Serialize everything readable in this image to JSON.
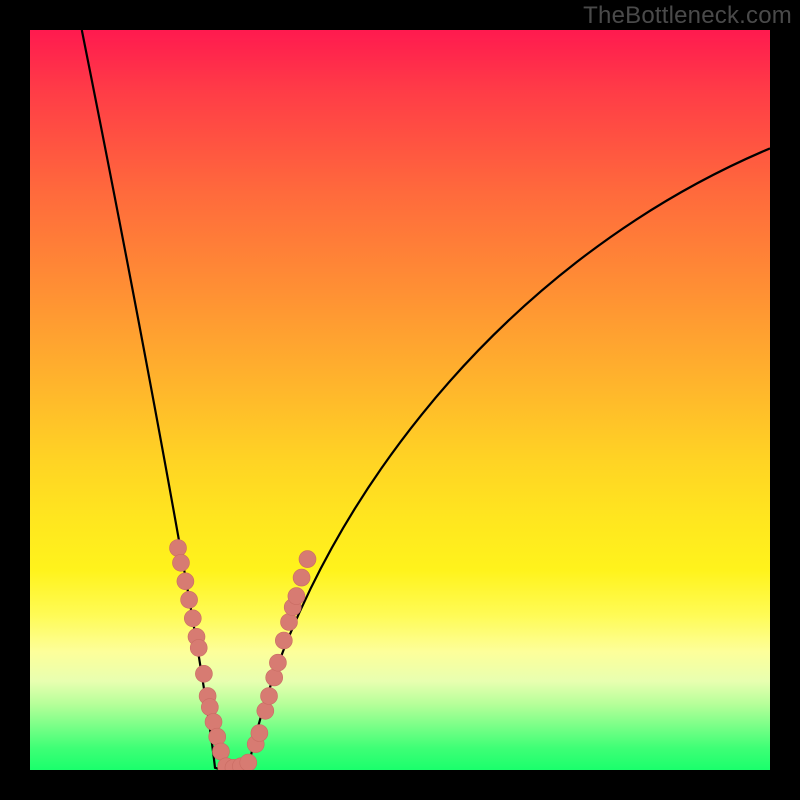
{
  "watermark": "TheBottleneck.com",
  "colors": {
    "curve_stroke": "#000000",
    "marker_fill": "#d77b72",
    "marker_stroke": "#c96c63",
    "frame": "#000000"
  },
  "chart_data": {
    "type": "line",
    "title": "",
    "xlabel": "",
    "ylabel": "",
    "xlim": [
      0,
      100
    ],
    "ylim": [
      0,
      100
    ],
    "curve": {
      "minimum_x": 27,
      "minimum_y": 0,
      "left_branch_top_x": 7,
      "right_branch_top_x": 100,
      "right_branch_top_y": 84
    },
    "series": [
      {
        "name": "markers-left-branch",
        "points": [
          {
            "x": 20.0,
            "y": 30.0
          },
          {
            "x": 20.4,
            "y": 28.0
          },
          {
            "x": 21.0,
            "y": 25.5
          },
          {
            "x": 21.5,
            "y": 23.0
          },
          {
            "x": 22.0,
            "y": 20.5
          },
          {
            "x": 22.5,
            "y": 18.0
          },
          {
            "x": 22.8,
            "y": 16.5
          },
          {
            "x": 23.5,
            "y": 13.0
          },
          {
            "x": 24.0,
            "y": 10.0
          },
          {
            "x": 24.3,
            "y": 8.5
          },
          {
            "x": 24.8,
            "y": 6.5
          },
          {
            "x": 25.3,
            "y": 4.5
          },
          {
            "x": 25.8,
            "y": 2.5
          }
        ]
      },
      {
        "name": "markers-bottom",
        "points": [
          {
            "x": 26.5,
            "y": 0.5
          },
          {
            "x": 27.5,
            "y": 0.3
          },
          {
            "x": 28.5,
            "y": 0.5
          },
          {
            "x": 29.5,
            "y": 1.0
          }
        ]
      },
      {
        "name": "markers-right-branch",
        "points": [
          {
            "x": 30.5,
            "y": 3.5
          },
          {
            "x": 31.0,
            "y": 5.0
          },
          {
            "x": 31.8,
            "y": 8.0
          },
          {
            "x": 32.3,
            "y": 10.0
          },
          {
            "x": 33.0,
            "y": 12.5
          },
          {
            "x": 33.5,
            "y": 14.5
          },
          {
            "x": 34.3,
            "y": 17.5
          },
          {
            "x": 35.0,
            "y": 20.0
          },
          {
            "x": 35.5,
            "y": 22.0
          },
          {
            "x": 36.0,
            "y": 23.5
          },
          {
            "x": 36.7,
            "y": 26.0
          },
          {
            "x": 37.5,
            "y": 28.5
          }
        ]
      }
    ]
  }
}
